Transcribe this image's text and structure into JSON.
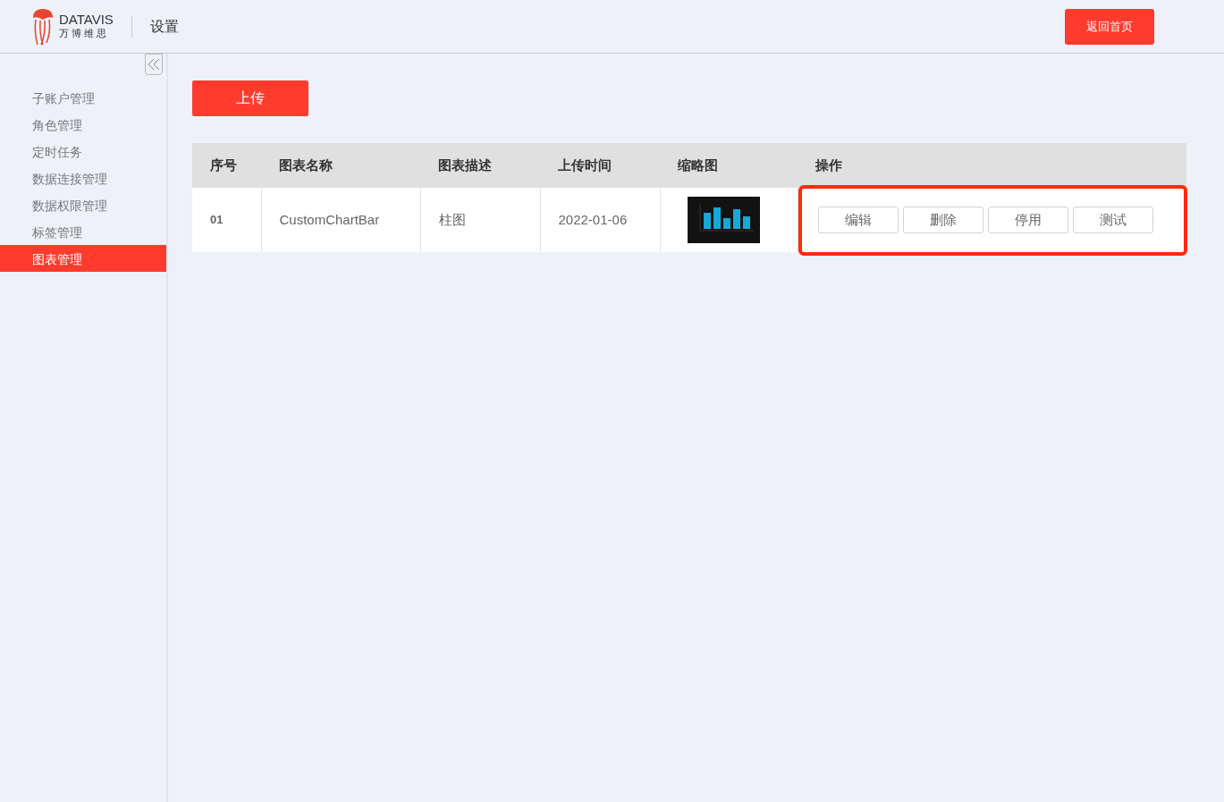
{
  "header": {
    "logo_text": "DATAVIS",
    "logo_subtext": "万 博 维 思",
    "title": "设置",
    "home_button": "返回首页"
  },
  "sidebar": {
    "items": [
      {
        "label": "子账户管理",
        "selected": false
      },
      {
        "label": "角色管理",
        "selected": false
      },
      {
        "label": "定时任务",
        "selected": false
      },
      {
        "label": "数据连接管理",
        "selected": false
      },
      {
        "label": "数据权限管理",
        "selected": false
      },
      {
        "label": "标签管理",
        "selected": false
      },
      {
        "label": "图表管理",
        "selected": true
      }
    ]
  },
  "upload_button": "上传",
  "table": {
    "columns": [
      "序号",
      "图表名称",
      "图表描述",
      "上传时间",
      "缩略图",
      "操作"
    ],
    "rows": [
      {
        "index": "01",
        "name": "CustomChartBar",
        "description": "柱图",
        "upload_time": "2022-01-06",
        "actions": [
          "编辑",
          "删除",
          "停用",
          "测试"
        ]
      }
    ]
  }
}
